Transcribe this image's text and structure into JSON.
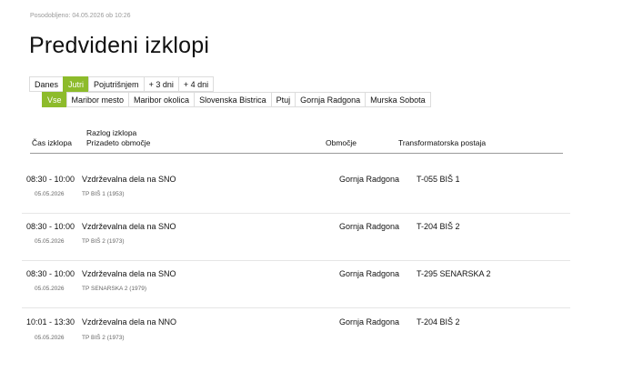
{
  "updated": "Posodobljeno: 04.05.2026 ob 10:26",
  "title": "Predvideni izklopi",
  "day_tabs": [
    {
      "label": "Danes",
      "active": false
    },
    {
      "label": "Jutri",
      "active": true
    },
    {
      "label": "Pojutrišnjem",
      "active": false
    },
    {
      "label": "+ 3 dni",
      "active": false
    },
    {
      "label": "+ 4 dni",
      "active": false
    }
  ],
  "area_tabs": [
    {
      "label": "Vse",
      "active": true
    },
    {
      "label": "Maribor mesto",
      "active": false
    },
    {
      "label": "Maribor okolica",
      "active": false
    },
    {
      "label": "Slovenska Bistrica",
      "active": false
    },
    {
      "label": "Ptuj",
      "active": false
    },
    {
      "label": "Gornja Radgona",
      "active": false
    },
    {
      "label": "Murska Sobota",
      "active": false
    }
  ],
  "table": {
    "col_time": "Čas izklopa",
    "col_reason": "Razlog izklopa",
    "col_affected": "Prizadeto območje",
    "col_area": "Območje",
    "col_station": "Transformatorska postaja",
    "rows": [
      {
        "time": "08:30 - 10:00",
        "date": "05.05.2026",
        "reason": "Vzdrževalna dela na SNO",
        "affected": "TP BIŠ 1 (1953)",
        "area": "Gornja Radgona",
        "station": "T-055 BIŠ 1"
      },
      {
        "time": "08:30 - 10:00",
        "date": "05.05.2026",
        "reason": "Vzdrževalna dela na SNO",
        "affected": "TP BIŠ 2 (1973)",
        "area": "Gornja Radgona",
        "station": "T-204 BIŠ 2"
      },
      {
        "time": "08:30 - 10:00",
        "date": "05.05.2026",
        "reason": "Vzdrževalna dela na SNO",
        "affected": "TP SENARSKA 2 (1979)",
        "area": "Gornja Radgona",
        "station": "T-295 SENARSKA 2"
      },
      {
        "time": "10:01 - 13:30",
        "date": "05.05.2026",
        "reason": "Vzdrževalna dela na NNO",
        "affected": "TP BIŠ 2 (1973)",
        "area": "Gornja Radgona",
        "station": "T-204 BIŠ 2"
      }
    ]
  },
  "colors": {
    "accent": "#8dbb2b"
  }
}
